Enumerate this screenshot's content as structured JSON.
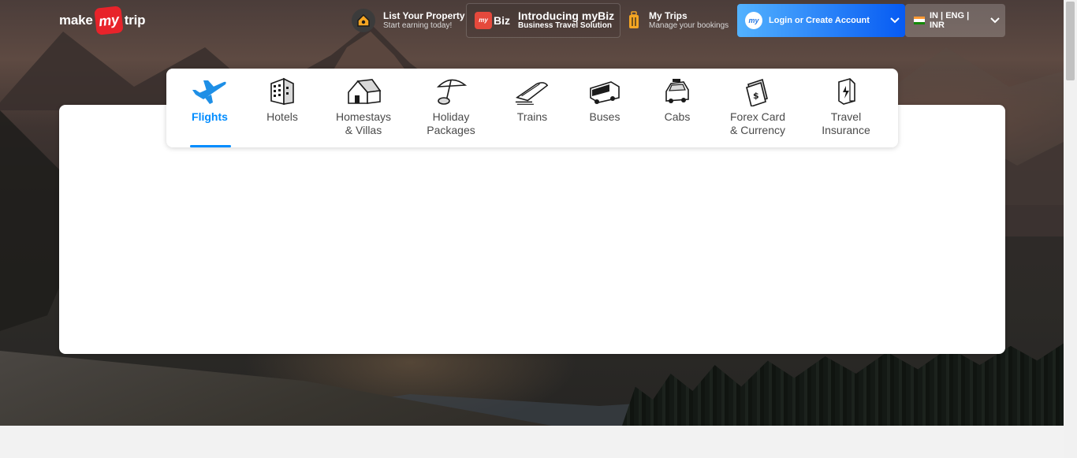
{
  "brand": {
    "logo_pre": "make",
    "logo_mid": "my",
    "logo_post": "trip"
  },
  "header": {
    "list_property": {
      "title": "List Your Property",
      "subtitle": "Start earning today!"
    },
    "mybiz": {
      "badge": "Biz",
      "bag_text": "my",
      "title": "Introducing myBiz",
      "subtitle": "Business Travel Solution"
    },
    "my_trips": {
      "title": "My Trips",
      "subtitle": "Manage your bookings"
    },
    "login": {
      "avatar_text": "my",
      "label": "Login or Create Account"
    },
    "locale": {
      "label": "IN | ENG | INR"
    }
  },
  "tabs": [
    {
      "label_1": "Flights",
      "label_2": "",
      "icon": "plane-icon",
      "active": true
    },
    {
      "label_1": "Hotels",
      "label_2": "",
      "icon": "hotel-building-icon",
      "active": false
    },
    {
      "label_1": "Homestays",
      "label_2": "& Villas",
      "icon": "homestay-house-icon",
      "active": false
    },
    {
      "label_1": "Holiday",
      "label_2": "Packages",
      "icon": "beach-umbrella-icon",
      "active": false
    },
    {
      "label_1": "Trains",
      "label_2": "",
      "icon": "train-icon",
      "active": false
    },
    {
      "label_1": "Buses",
      "label_2": "",
      "icon": "bus-icon",
      "active": false
    },
    {
      "label_1": "Cabs",
      "label_2": "",
      "icon": "cab-icon",
      "active": false
    },
    {
      "label_1": "Forex Card",
      "label_2": "& Currency",
      "icon": "forex-card-icon",
      "active": false
    },
    {
      "label_1": "Travel",
      "label_2": "Insurance",
      "icon": "insurance-shield-icon",
      "active": false
    }
  ],
  "colors": {
    "accent": "#008cff",
    "login_gradient_start": "#53b2fe",
    "login_gradient_end": "#065af3",
    "brand_red": "#e8232a"
  }
}
